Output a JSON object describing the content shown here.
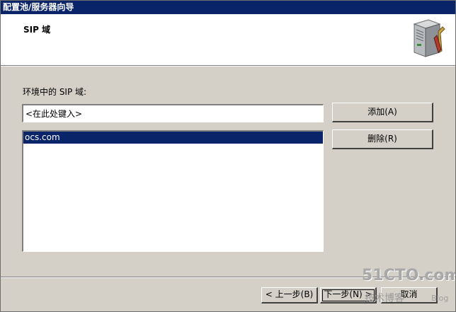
{
  "window": {
    "title": "配置池/服务器向导"
  },
  "header": {
    "title": "SIP 域",
    "icon": "server-tools-icon"
  },
  "main": {
    "domains_label": "环境中的 SIP 域:",
    "domain_input": {
      "value": "",
      "placeholder": "<在此处键入>"
    },
    "domain_list": {
      "items": [
        {
          "label": "ocs.com",
          "selected": true
        }
      ]
    },
    "add_button": "添加(A)",
    "remove_button": "删除(R)"
  },
  "footer": {
    "back_button": "< 上一步(B)",
    "next_button": "下一步(N) >",
    "cancel_button": "取消"
  },
  "watermark": {
    "main": "51CTO.com",
    "sub": "技术博客",
    "blog": "Blog"
  },
  "colors": {
    "titlebar": "#0a246a",
    "dialog_face": "#d4d0c8",
    "selection": "#0a246a"
  }
}
